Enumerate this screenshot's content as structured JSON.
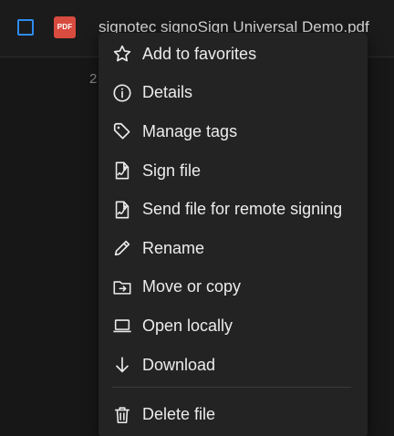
{
  "file_row": {
    "badge": "PDF",
    "file_name": "signotec signoSign Universal Demo.pdf",
    "partial_number": "2"
  },
  "menu": {
    "items": [
      {
        "label": "Add to favorites",
        "icon": "star-icon"
      },
      {
        "label": "Details",
        "icon": "info-icon"
      },
      {
        "label": "Manage tags",
        "icon": "tag-icon"
      },
      {
        "label": "Sign file",
        "icon": "sign-file-icon"
      },
      {
        "label": "Send file for remote signing",
        "icon": "sign-remote-icon"
      },
      {
        "label": "Rename",
        "icon": "pencil-icon"
      },
      {
        "label": "Move or copy",
        "icon": "folder-move-icon"
      },
      {
        "label": "Open locally",
        "icon": "laptop-icon"
      },
      {
        "label": "Download",
        "icon": "arrow-down-icon"
      }
    ],
    "delete": {
      "label": "Delete file",
      "icon": "trash-icon"
    }
  },
  "colors": {
    "background": "#171717",
    "menu_background": "#232323",
    "checkbox_accent": "#2d8cf0",
    "pdf_badge": "#d84b3f",
    "text": "#ececec"
  }
}
